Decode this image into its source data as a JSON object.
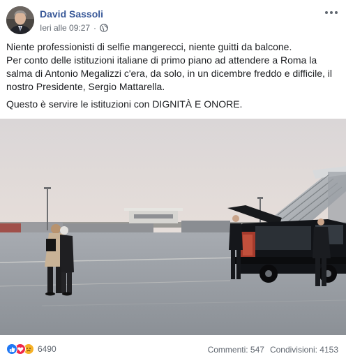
{
  "post": {
    "author": "David Sassoli",
    "timestamp": "Ieri alle 09:27",
    "separator": "·",
    "privacy_icon": "globe-icon",
    "more_icon": "more-options-icon",
    "text_lines": [
      "Niente professionisti di selfie mangerecci, niente guitti da balcone.",
      "Per conto delle istituzioni italiane di primo piano ad attendere a Roma la",
      "salma di Antonio Megalizzi c'era, da solo, in un dicembre freddo e difficile, il",
      "nostro Presidente, Sergio Mattarella."
    ],
    "closing_line": "Questo è servire le istituzioni con DIGNITÀ E ONORE."
  },
  "footer": {
    "reaction_icons": [
      "like-icon",
      "love-icon",
      "sad-icon"
    ],
    "reaction_count": "6490",
    "comments": "Commenti: 547",
    "shares": "Condivisioni: 4153"
  },
  "colors": {
    "author_link": "#385898",
    "meta_text": "#606770",
    "like": "#2078f4",
    "love": "#f0284a",
    "sad": "#f7b125"
  }
}
